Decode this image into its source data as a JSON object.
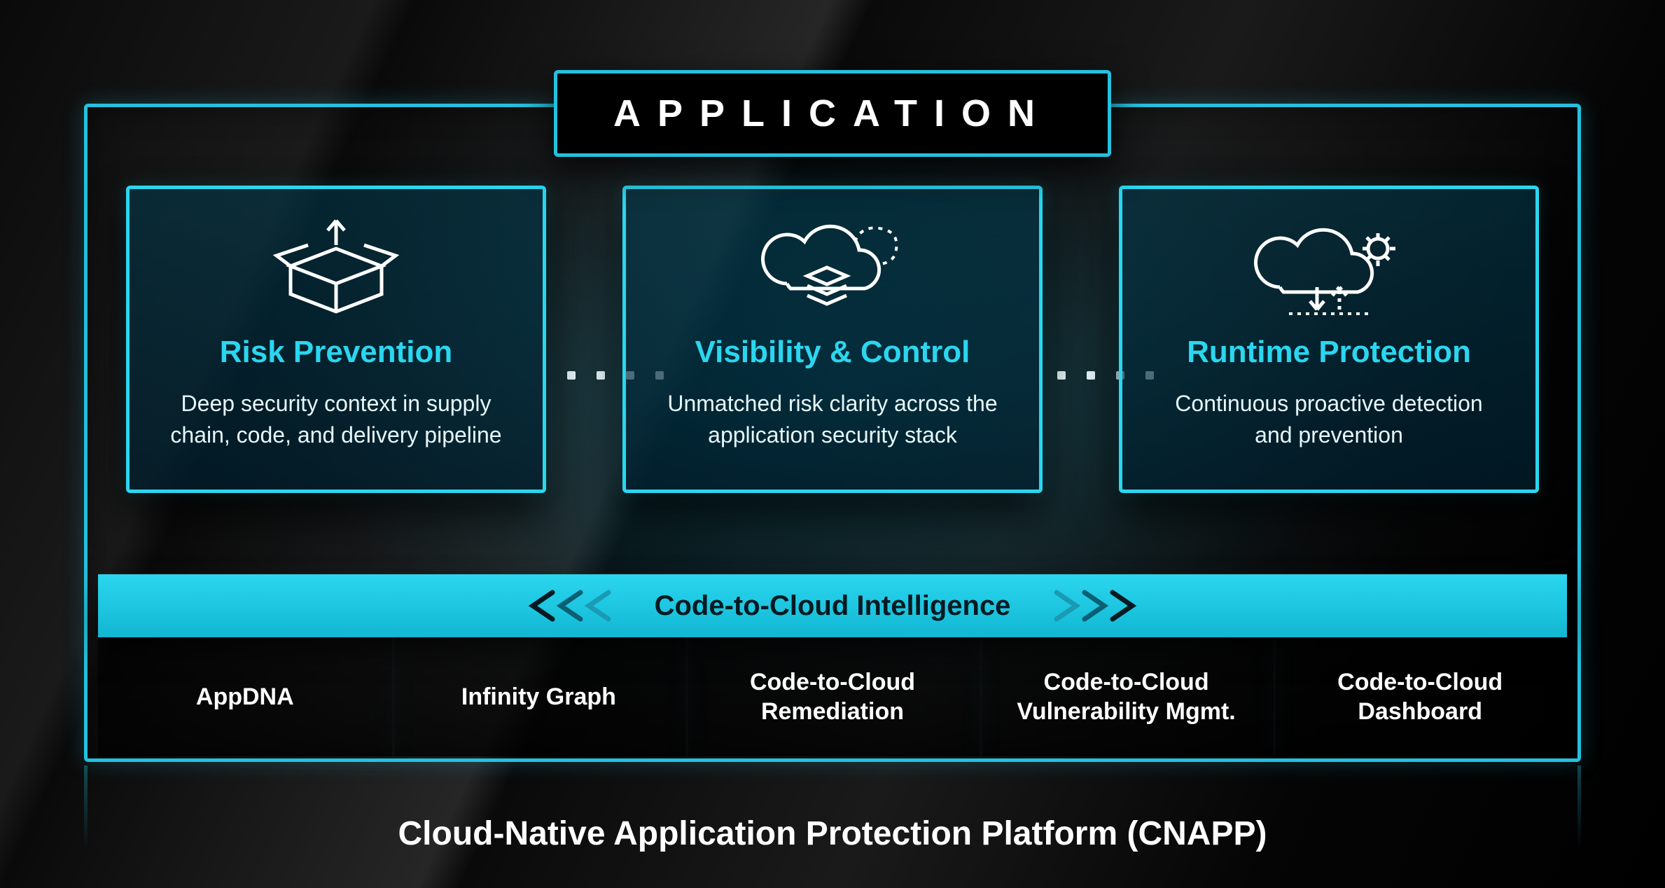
{
  "header": {
    "application_label": "APPLICATION"
  },
  "cards": [
    {
      "icon": "box-up-arrow-icon",
      "title": "Risk Prevention",
      "desc": "Deep security context in supply chain, code, and delivery pipeline"
    },
    {
      "icon": "cloud-layers-icon",
      "title": "Visibility & Control",
      "desc": "Unmatched risk clarity across the application security stack"
    },
    {
      "icon": "cloud-gear-icon",
      "title": "Runtime Protection",
      "desc": "Continuous proactive detection and prevention"
    }
  ],
  "intelligence_bar": {
    "label": "Code-to-Cloud Intelligence"
  },
  "features": [
    "AppDNA",
    "Infinity Graph",
    "Code-to-Cloud Remediation",
    "Code-to-Cloud Vulnerability Mgmt.",
    "Code-to-Cloud Dashboard"
  ],
  "footer": {
    "title": "Cloud-Native Application Protection Platform (CNAPP)"
  },
  "colors": {
    "accent": "#2bd6ef",
    "frame": "#24c1de"
  }
}
